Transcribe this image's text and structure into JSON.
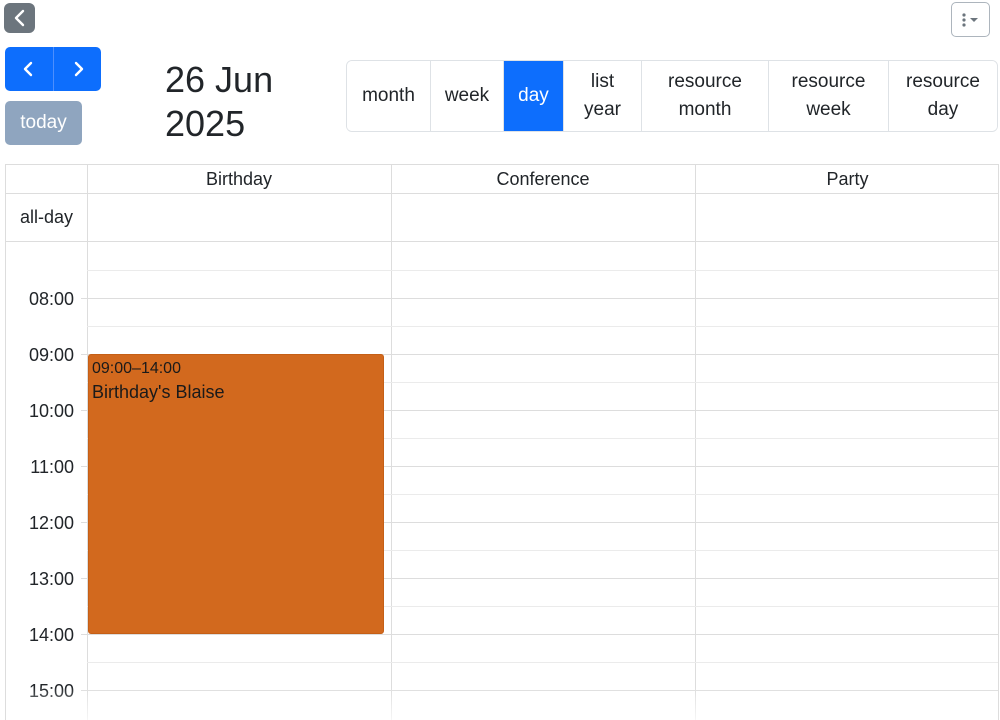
{
  "toolbar": {
    "back_icon": "chevron-left-icon",
    "menu_icon": "kebab-dropdown-icon",
    "prev_icon": "chevron-left-icon",
    "next_icon": "chevron-right-icon",
    "today_label": "today",
    "title_line1": "26 Jun",
    "title_line2": "2025",
    "accent_color": "#0d6efd",
    "views": [
      {
        "line1": "month",
        "line2": ""
      },
      {
        "line1": "week",
        "line2": ""
      },
      {
        "line1": "day",
        "line2": "",
        "active": true
      },
      {
        "line1": "list",
        "line2": "year"
      },
      {
        "line1": "resource",
        "line2": "month"
      },
      {
        "line1": "resource",
        "line2": "week"
      },
      {
        "line1": "resource",
        "line2": "day"
      }
    ]
  },
  "calendar": {
    "resources": [
      "Birthday",
      "Conference",
      "Party"
    ],
    "allday_label": "all-day",
    "time_labels": [
      "08:00",
      "09:00",
      "10:00",
      "11:00",
      "12:00",
      "13:00",
      "14:00",
      "15:00"
    ],
    "event": {
      "resource": "Birthday",
      "time": "09:00–14:00",
      "title": "Birthday's Blaise",
      "color": "#d2691e"
    }
  }
}
